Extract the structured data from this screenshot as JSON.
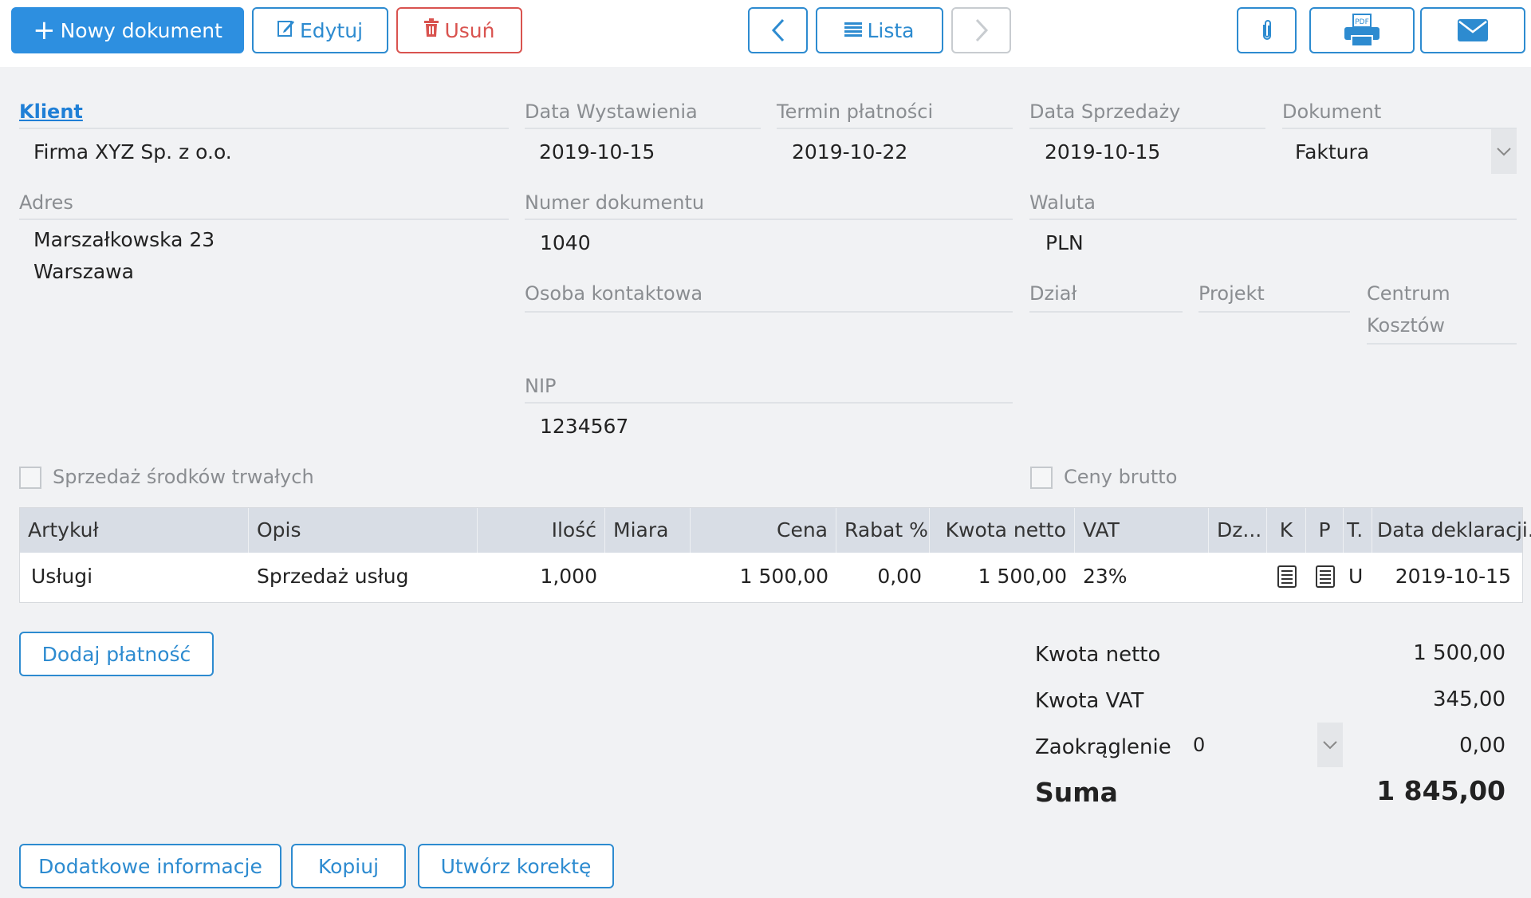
{
  "toolbar": {
    "new_label": "Nowy dokument",
    "edit_label": "Edytuj",
    "delete_label": "Usuń",
    "list_label": "Lista"
  },
  "form": {
    "client_label": "Klient",
    "client_value": "Firma XYZ Sp. z o.o.",
    "issue_date_label": "Data Wystawienia",
    "issue_date_value": "2019-10-15",
    "due_date_label": "Termin płatności",
    "due_date_value": "2019-10-22",
    "sale_date_label": "Data Sprzedaży",
    "sale_date_value": "2019-10-15",
    "document_label": "Dokument",
    "document_value": "Faktura",
    "address_label": "Adres",
    "address_line1": "Marszałkowska 23",
    "address_line2": "Warszawa",
    "doc_number_label": "Numer dokumentu",
    "doc_number_value": "1040",
    "currency_label": "Waluta",
    "currency_value": "PLN",
    "contact_label": "Osoba kontaktowa",
    "department_label": "Dział",
    "project_label": "Projekt",
    "cost_center_label_line1": "Centrum",
    "cost_center_label_line2": "Kosztów",
    "nip_label": "NIP",
    "nip_value": "1234567",
    "fixed_assets_label": "Sprzedaż środków trwałych",
    "gross_prices_label": "Ceny brutto"
  },
  "table": {
    "headers": [
      "Artykuł",
      "Opis",
      "Ilość",
      "Miara",
      "Cena",
      "Rabat %",
      "Kwota netto",
      "VAT",
      "Dz...",
      "K",
      "P",
      "T.",
      "Data deklaracji..."
    ],
    "rows": [
      {
        "artykul": "Usługi",
        "opis": "Sprzedaż usług",
        "ilosc": "1,000",
        "miara": "",
        "cena": "1 500,00",
        "rabat": "0,00",
        "netto": "1 500,00",
        "vat": "23%",
        "dz": "",
        "t": "U",
        "data": "2019-10-15"
      }
    ]
  },
  "buttons": {
    "add_payment": "Dodaj płatność",
    "additional_info": "Dodatkowe informacje",
    "copy": "Kopiuj",
    "correction": "Utwórz korektę"
  },
  "summary": {
    "net_label": "Kwota netto",
    "net_value": "1 500,00",
    "vat_label": "Kwota VAT",
    "vat_value": "345,00",
    "rounding_label": "Zaokrąglenie",
    "rounding_select": "0",
    "rounding_value": "0,00",
    "total_label": "Suma",
    "total_value": "1 845,00"
  },
  "colors": {
    "accent": "#2d8fe0",
    "danger": "#d9534f",
    "header_bg": "#d8dde5"
  }
}
